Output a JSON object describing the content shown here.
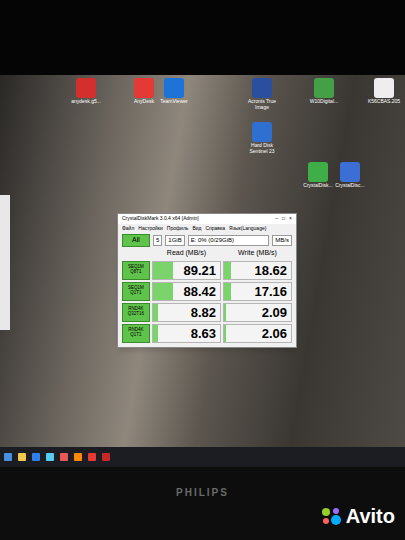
{
  "desktop_icons": [
    {
      "label": "anydesk.g5...",
      "color": "#d32f2f"
    },
    {
      "label": "AnyDesk",
      "color": "#e53935"
    },
    {
      "label": "TeamViewer",
      "color": "#1e73d8"
    },
    {
      "label": "Acronis True Image",
      "color": "#2b4f9e"
    },
    {
      "label": "W10Digital...",
      "color": "#43a047"
    },
    {
      "label": "K56CBAS.205",
      "color": "#eeeeee"
    },
    {
      "label": "Hard Disk Sentinel 23",
      "color": "#2f6fd0"
    },
    {
      "label": "CrystalDisk...",
      "color": "#3fae49"
    },
    {
      "label": "CrystalDisc...",
      "color": "#3b6fd6"
    }
  ],
  "window": {
    "title": "CrystalDiskMark 3.0.4 x64 [Admin]",
    "controls": [
      "–",
      "□",
      "×"
    ]
  },
  "menu": [
    "Файл",
    "Настройки",
    "Профиль",
    "Вид",
    "Справка",
    "Язык(Language)"
  ],
  "toolbar": {
    "all_button": "All",
    "count": "5",
    "size": "1GiB",
    "drive": "E: 0% (0/29GiB)",
    "unit": "MB/s"
  },
  "columns": [
    "Read (MB/s)",
    "Write (MB/s)"
  ],
  "rows": [
    {
      "label": "SEQ1M",
      "sub": "Q8T1",
      "read": {
        "value": "89.21",
        "level": 0.3
      },
      "write": {
        "value": "18.62",
        "level": 0.1
      }
    },
    {
      "label": "SEQ1M",
      "sub": "Q1T1",
      "read": {
        "value": "88.42",
        "level": 0.3
      },
      "write": {
        "value": "17.16",
        "level": 0.1
      }
    },
    {
      "label": "RND4K",
      "sub": "Q32T16",
      "read": {
        "value": "8.82",
        "level": 0.08
      },
      "write": {
        "value": "2.09",
        "level": 0.03
      }
    },
    {
      "label": "RND4K",
      "sub": "Q1T1",
      "read": {
        "value": "8.63",
        "level": 0.08
      },
      "write": {
        "value": "2.06",
        "level": 0.03
      }
    }
  ],
  "monitor": {
    "brand": "PHILIPS"
  },
  "watermark": "Avito"
}
